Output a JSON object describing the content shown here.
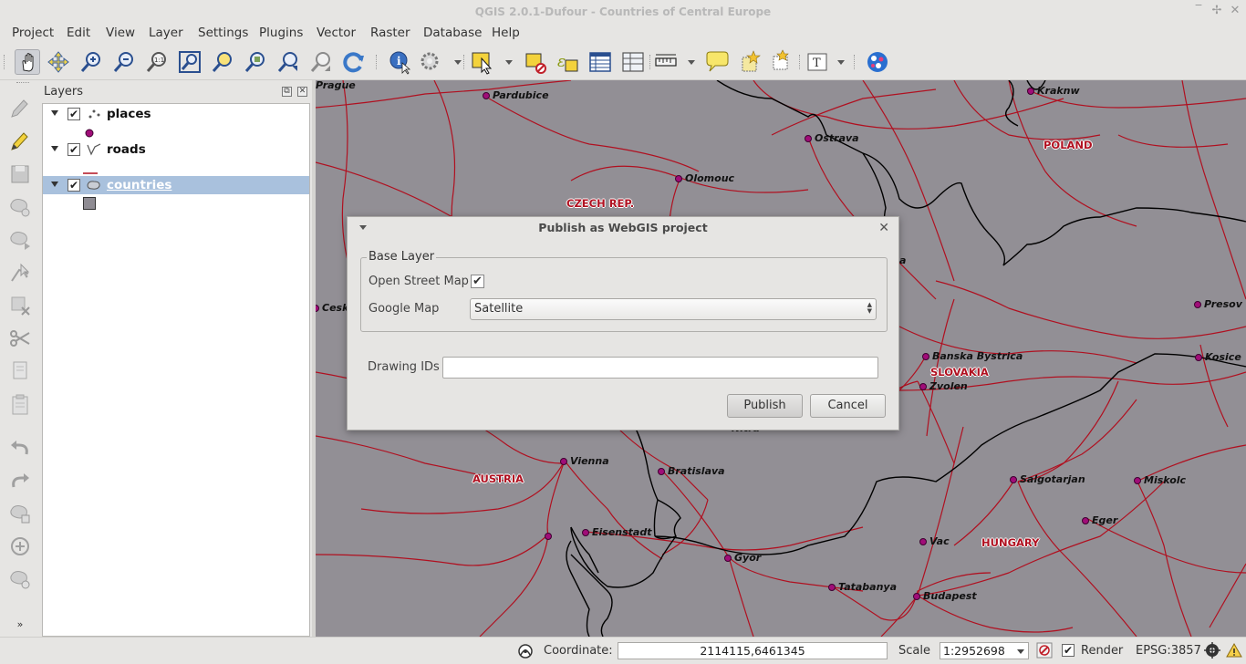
{
  "window": {
    "title": "QGIS 2.0.1-Dufour - Countries of Central Europe"
  },
  "menubar": {
    "items": [
      "Project",
      "Edit",
      "View",
      "Layer",
      "Settings",
      "Plugins",
      "Vector",
      "Raster",
      "Database",
      "Help"
    ]
  },
  "layers_panel": {
    "title": "Layers",
    "layers": [
      {
        "name": "places",
        "checked": true,
        "type": "point",
        "legend_color": "#a00d78"
      },
      {
        "name": "roads",
        "checked": true,
        "type": "line",
        "legend_color": "#b01020"
      },
      {
        "name": "countries",
        "checked": true,
        "type": "polygon",
        "legend_color": "#8f8c93",
        "selected": true
      }
    ]
  },
  "map": {
    "background": "#928f95",
    "places": [
      "Prague",
      "Pardubice",
      "Kraknw",
      "Ostrava",
      "Olomouc",
      "Presov",
      "Cesk",
      "Banska Bystrica",
      "Kosice",
      "Zvolen",
      "Vienna",
      "Bratislava",
      "Salgotarjan",
      "Miskolc",
      "Eisenstadt",
      "Eger",
      "Vac",
      "Gyor",
      "Tatabanya",
      "Budapest"
    ],
    "countries": [
      "POLAND",
      "CZECH REP.",
      "SLOVAKIA",
      "AUSTRIA",
      "HUNGARY"
    ],
    "fragments": {
      "a": "a",
      "nitra": "Nitra"
    },
    "road_color": "#b01020",
    "border_color": "#000000",
    "place_color": "#a00d78"
  },
  "dialog": {
    "title": "Publish as WebGIS project",
    "group_title": "Base Layer",
    "osm_label": "Open Street Map",
    "osm_checked": true,
    "google_label": "Google Map",
    "google_value": "Satellite",
    "drawing_ids_label": "Drawing IDs",
    "drawing_ids_value": "",
    "publish_label": "Publish",
    "cancel_label": "Cancel"
  },
  "statusbar": {
    "coordinate_label": "Coordinate:",
    "coordinate_value": "2114115,6461345",
    "scale_label": "Scale",
    "scale_value": "1:2952698",
    "render_label": "Render",
    "render_checked": true,
    "crs": "EPSG:3857"
  },
  "icons": {
    "toolbar": [
      "pan-icon",
      "pan-to-selection-icon",
      "zoom-in-icon",
      "zoom-out-icon",
      "zoom-native-icon",
      "zoom-full-icon",
      "zoom-to-selection-icon",
      "zoom-to-layer-icon",
      "zoom-last-icon",
      "zoom-next-icon",
      "refresh-icon",
      "identify-icon",
      "action-icon",
      "select-icon",
      "deselect-icon",
      "expression-select-icon",
      "attribute-table-icon",
      "field-calculator-icon",
      "measure-icon",
      "map-tips-icon",
      "new-bookmark-icon",
      "show-bookmarks-icon",
      "text-annotation-icon",
      "webgis-globe-icon"
    ]
  }
}
